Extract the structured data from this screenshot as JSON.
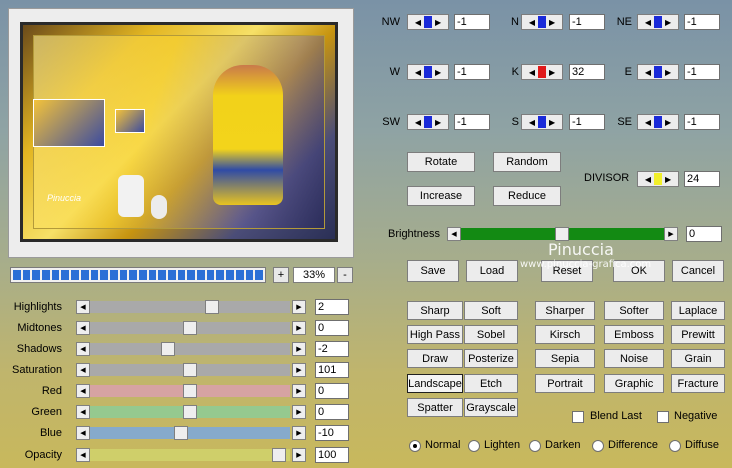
{
  "preview": {
    "zoom": "33%",
    "plus": "+",
    "minus": "-",
    "progress_segments": 26,
    "signature": "Pinuccia"
  },
  "sliders": [
    {
      "label": "Highlights",
      "value": "2",
      "track": "#a9a9a9",
      "pos": 0.62
    },
    {
      "label": "Midtones",
      "value": "0",
      "track": "#a9a9a9",
      "pos": 0.5
    },
    {
      "label": "Shadows",
      "value": "-2",
      "track": "#a9a9a9",
      "pos": 0.38
    },
    {
      "label": "Saturation",
      "value": "101",
      "track": "#a9a9a9",
      "pos": 0.5
    },
    {
      "label": "Red",
      "value": "0",
      "track": "#d6a3a3",
      "pos": 0.5
    },
    {
      "label": "Green",
      "value": "0",
      "track": "#95c98f",
      "pos": 0.5
    },
    {
      "label": "Blue",
      "value": "-10",
      "track": "#86aacb",
      "pos": 0.45
    },
    {
      "label": "Opacity",
      "value": "100",
      "track": "#cfcf6a",
      "pos": 0.98
    }
  ],
  "matrix": [
    {
      "label": "NW",
      "value": "-1",
      "color": "#1a2ad8"
    },
    {
      "label": "N",
      "value": "-1",
      "color": "#1a2ad8"
    },
    {
      "label": "NE",
      "value": "-1",
      "color": "#1a2ad8"
    },
    {
      "label": "W",
      "value": "-1",
      "color": "#1a2ad8"
    },
    {
      "label": "K",
      "value": "32",
      "color": "#e0191a"
    },
    {
      "label": "E",
      "value": "-1",
      "color": "#1a2ad8"
    },
    {
      "label": "SW",
      "value": "-1",
      "color": "#1a2ad8"
    },
    {
      "label": "S",
      "value": "-1",
      "color": "#1a2ad8"
    },
    {
      "label": "SE",
      "value": "-1",
      "color": "#1a2ad8"
    }
  ],
  "actions": {
    "rotate": "Rotate",
    "random": "Random",
    "increase": "Increase",
    "reduce": "Reduce"
  },
  "divisor": {
    "label": "DIVISOR",
    "value": "24",
    "color": "#f1ef2a"
  },
  "brightness": {
    "label": "Brightness",
    "value": "0",
    "track": "#138a13"
  },
  "dialog": {
    "save": "Save",
    "load": "Load",
    "reset": "Reset",
    "ok": "OK",
    "cancel": "Cancel"
  },
  "watermark": {
    "name": "Pinuccia",
    "site": "www.pinuccia-grafica.com"
  },
  "presets": [
    [
      "Sharp",
      "Soft",
      "Sharper",
      "Softer",
      "Laplace"
    ],
    [
      "High Pass",
      "Sobel",
      "Kirsch",
      "Emboss",
      "Prewitt"
    ],
    [
      "Draw",
      "Posterize",
      "Sepia",
      "Noise",
      "Grain"
    ],
    [
      "Landscape",
      "Etch",
      "Portrait",
      "Graphic",
      "Fracture"
    ],
    [
      "Spatter",
      "Grayscale"
    ]
  ],
  "options": {
    "blend_last": "Blend Last",
    "negative": "Negative"
  },
  "modes": [
    "Normal",
    "Lighten",
    "Darken",
    "Difference",
    "Diffuse"
  ]
}
